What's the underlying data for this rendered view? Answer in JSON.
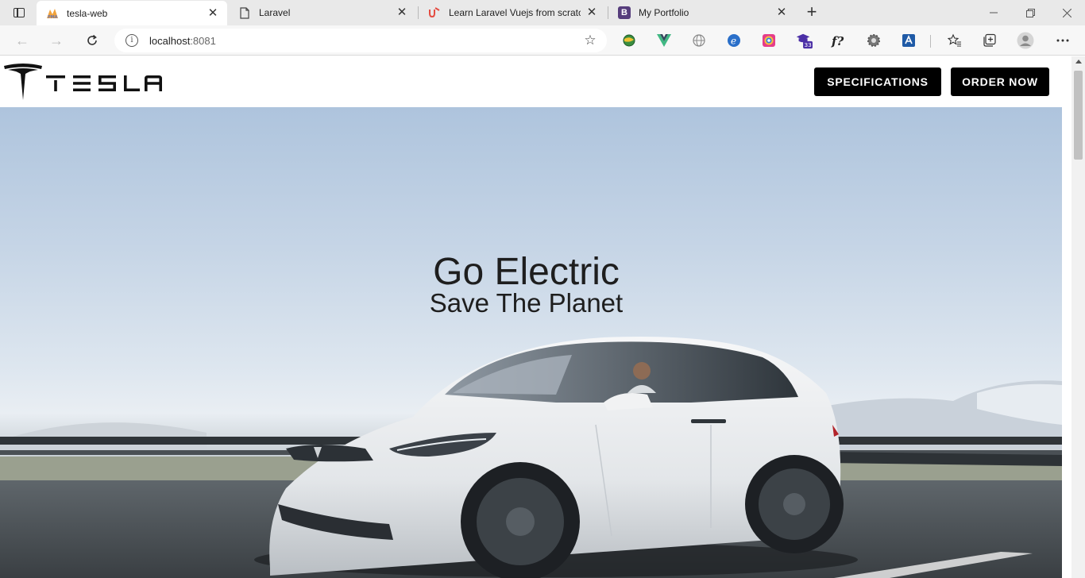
{
  "browser": {
    "tabs": [
      {
        "title": "tesla-web",
        "favicon": "phpmyadmin-icon",
        "active": true
      },
      {
        "title": "Laravel",
        "favicon": "page-icon",
        "active": false
      },
      {
        "title": "Learn Laravel Vuejs from scratch",
        "favicon": "udemy-icon",
        "active": false
      },
      {
        "title": "My Portfolio",
        "favicon": "bootstrap-icon",
        "favicon_text": "B",
        "active": false
      }
    ],
    "address": {
      "host": "localhost",
      "port": ":8081"
    },
    "extension_badge": "33",
    "extensions": [
      "globe-extension-icon",
      "vue-devtools-icon",
      "web-icon",
      "ie-tab-icon",
      "color-picker-icon",
      "graduation-cap-icon",
      "fonts-ninja-icon",
      "settings-extension-icon",
      "translate-icon"
    ]
  },
  "site": {
    "brand": "TESLA",
    "nav": {
      "specifications": "SPECIFICATIONS",
      "order": "ORDER NOW"
    },
    "hero": {
      "title": "Go Electric",
      "subtitle": "Save The Planet"
    }
  },
  "colors": {
    "nav_button_bg": "#000000",
    "nav_button_text": "#ffffff",
    "hero_text": "#1e1e1e",
    "car_body": "#eef0f2"
  }
}
